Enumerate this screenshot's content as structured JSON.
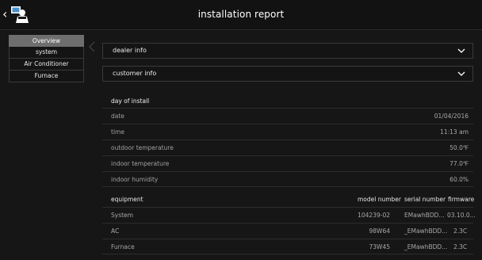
{
  "header": {
    "title": "installation report"
  },
  "sidebar": {
    "items": [
      {
        "label": "Overview"
      },
      {
        "label": "system"
      },
      {
        "label": "Air Conditioner"
      },
      {
        "label": "Furnace"
      }
    ]
  },
  "accordions": [
    {
      "label": "dealer info"
    },
    {
      "label": "customer info"
    }
  ],
  "install": {
    "section_title": "day of install",
    "rows": [
      {
        "label": "date",
        "value": "01/04/2016"
      },
      {
        "label": "time",
        "value": "11:13 am"
      },
      {
        "label": "outdoor temperature",
        "value": "50.0℉"
      },
      {
        "label": "indoor temperature",
        "value": "77.0℉"
      },
      {
        "label": "indoor humidity",
        "value": "60.0%"
      }
    ]
  },
  "equipment": {
    "headers": {
      "name": "equipment",
      "model": "model number",
      "serial": "serial number",
      "firmware": "firmware"
    },
    "rows": [
      {
        "name": "System",
        "model": "104239-02",
        "serial": "EMawhBDD...",
        "firmware": "03.10.0..."
      },
      {
        "name": "AC",
        "model": "98W64",
        "serial": "_EMawhBDD...",
        "firmware": "2.3C"
      },
      {
        "name": "Furnace",
        "model": "73W45",
        "serial": "_EMawhBDD...",
        "firmware": "2.3C"
      }
    ]
  }
}
